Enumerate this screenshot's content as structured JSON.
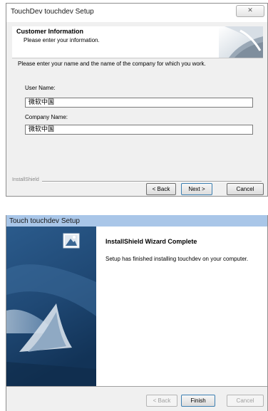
{
  "setup_window": {
    "title": "TouchDev touchdev Setup",
    "close_glyph": "✕",
    "header": {
      "title": "Customer Information",
      "subtitle": "Please enter your information."
    },
    "instructions": "Please enter your name and the name of the company for which you work.",
    "user_name_label": "User Name:",
    "user_name_value": "微软中国",
    "company_name_label": "Company Name:",
    "company_name_value": "微软中国",
    "brand_label": "InstallShield",
    "buttons": {
      "back": "< Back",
      "next": "Next >",
      "cancel": "Cancel"
    }
  },
  "complete_window": {
    "title": "Touch touchdev Setup",
    "heading": "InstallShield Wizard Complete",
    "message": "Setup has finished installing touchdev on your computer.",
    "buttons": {
      "back": "< Back",
      "finish": "Finish",
      "cancel": "Cancel"
    }
  },
  "colors": {
    "dialog_bg": "#f0f0f0",
    "title_bar_active": "#a9c6e8",
    "panel_dark": "#1f4874",
    "panel_mid": "#4a78a8"
  }
}
